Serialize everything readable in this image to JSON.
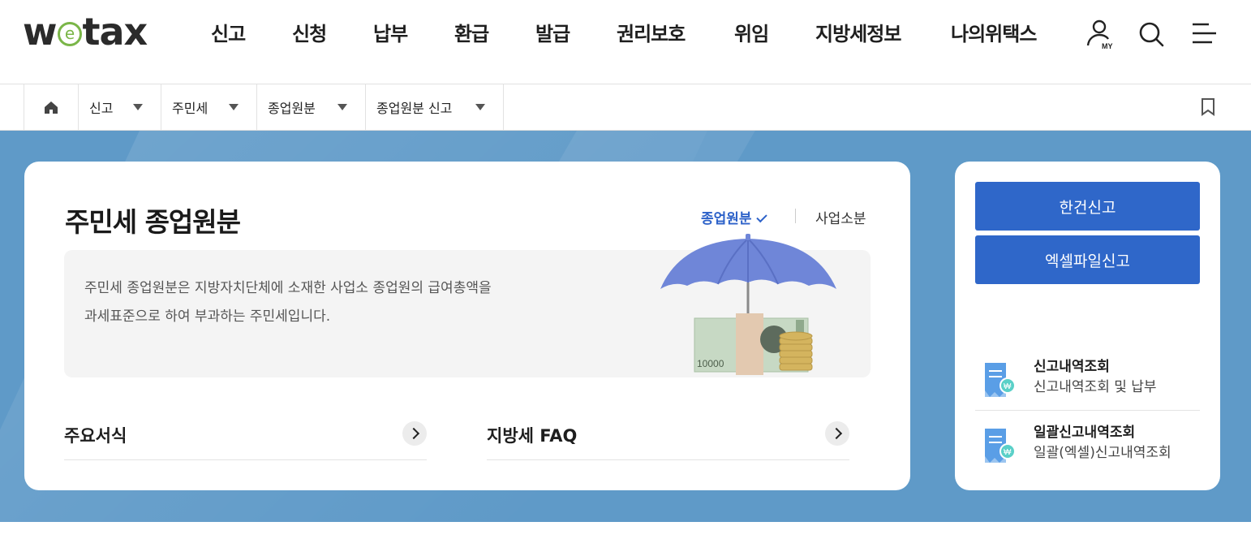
{
  "logo": {
    "pre": "w",
    "e": "e",
    "post": "tax"
  },
  "gnb": [
    "신고",
    "신청",
    "납부",
    "환급",
    "발급",
    "권리보호",
    "위임",
    "지방세정보",
    "나의위택스"
  ],
  "header_icons": {
    "my_label": "MY"
  },
  "breadcrumb": [
    "신고",
    "주민세",
    "종업원분",
    "종업원분 신고"
  ],
  "page": {
    "title": "주민세 종업원분",
    "tab_active": "종업원분",
    "tab_other": "사업소분",
    "description_line1": "주민세 종업원분은 지방자치단체에 소재한 사업소 종업원의 급여총액을",
    "description_line2": "과세표준으로 하여 부과하는 주민세입니다.",
    "banknote_label": "10000",
    "links": [
      "주요서식",
      "지방세 FAQ"
    ]
  },
  "side": {
    "btn_single": "한건신고",
    "btn_excel": "엑셀파일신고",
    "items": [
      {
        "title": "신고내역조회",
        "sub": "신고내역조회 및 납부"
      },
      {
        "title": "일괄신고내역조회",
        "sub": "일괄(엑셀)신고내역조회"
      }
    ]
  },
  "colors": {
    "accent": "#2f67c9",
    "band": "#5f9ac8",
    "logo_green": "#7ab648"
  }
}
